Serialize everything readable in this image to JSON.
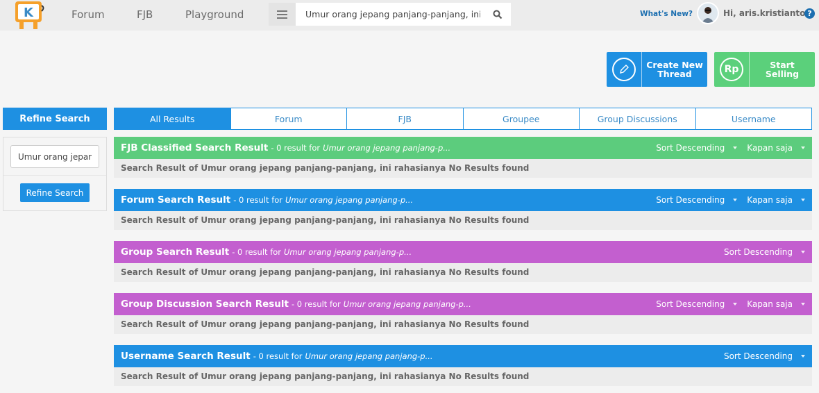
{
  "nav": {
    "logo_alt": "Kaskus",
    "links": [
      "Forum",
      "FJB",
      "Playground"
    ],
    "search_value": "Umur orang jepang panjang-panjang, ini rah",
    "whats_new": "What's New?",
    "greeting": "Hi, aris.kristianto",
    "help": "?"
  },
  "actions": {
    "create_thread": "Create New Thread",
    "create_icon": "pencil-icon",
    "start_selling": "Start Selling",
    "sell_icon_text": "Rp"
  },
  "sidebar": {
    "title": "Refine Search",
    "input_value": "Umur orang jepan",
    "button": "Refine Search"
  },
  "tabs": [
    {
      "label": "All Results",
      "active": true
    },
    {
      "label": "Forum",
      "active": false
    },
    {
      "label": "FJB",
      "active": false
    },
    {
      "label": "Groupee",
      "active": false
    },
    {
      "label": "Group Discussions",
      "active": false
    },
    {
      "label": "Username",
      "active": false
    }
  ],
  "sections": [
    {
      "title": "FJB Classified Search Result",
      "meta": "- 0 result for",
      "query": "Umur orang jepang panjang-p...",
      "sort": "Sort Descending",
      "time": "Kapan saja",
      "body": "Search Result of Umur orang jepang panjang-panjang, ini rahasianya No Results found",
      "color": "#5ccc7d"
    },
    {
      "title": "Forum Search Result",
      "meta": "- 0 result for",
      "query": "Umur orang jepang panjang-p...",
      "sort": "Sort Descending",
      "time": "Kapan saja",
      "body": "Search Result of Umur orang jepang panjang-panjang, ini rahasianya No Results found",
      "color": "#1e90e2"
    },
    {
      "title": "Group Search Result",
      "meta": "- 0 result for",
      "query": "Umur orang jepang panjang-p...",
      "sort": "Sort Descending",
      "body": "Search Result of Umur orang jepang panjang-panjang, ini rahasianya No Results found",
      "color": "#c35fcf"
    },
    {
      "title": "Group Discussion Search Result",
      "meta": "- 0 result for",
      "query": "Umur orang jepang panjang-p...",
      "sort": "Sort Descending",
      "time": "Kapan saja",
      "body": "Search Result of Umur orang jepang panjang-panjang, ini rahasianya No Results found",
      "color": "#c35fcf"
    },
    {
      "title": "Username Search Result",
      "meta": "- 0 result for",
      "query": "Umur orang jepang panjang-p...",
      "sort": "Sort Descending",
      "body": "Search Result of Umur orang jepang panjang-panjang, ini rahasianya No Results found",
      "color": "#1e90e2"
    }
  ]
}
